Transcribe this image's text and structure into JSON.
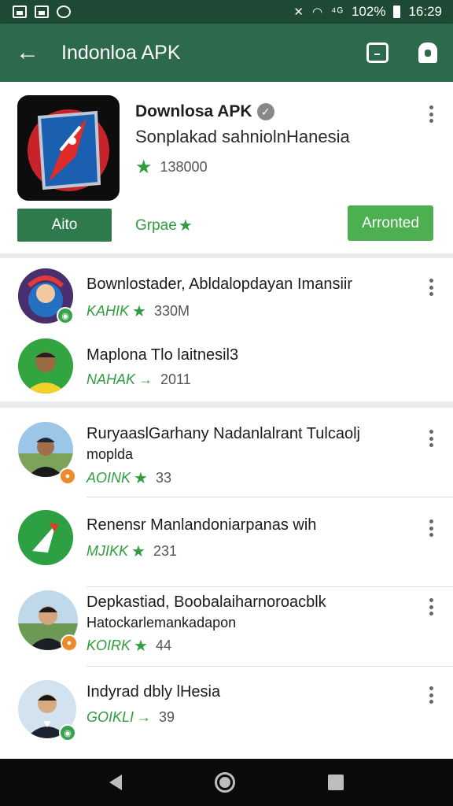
{
  "status_bar": {
    "battery_text": "102%",
    "time": "16:29",
    "signal_symbols": "⁴ᴳ"
  },
  "app_bar": {
    "title": "Indonloa APK",
    "icons": [
      "back-arrow-icon",
      "calendar-icon",
      "bell-icon"
    ]
  },
  "featured": {
    "title": "Downlosa APK",
    "subtitle": "Sonplakad sahniolnHanesia",
    "rating_count": "138000",
    "install_label": "Aito",
    "link_label": "Grpae",
    "accent_button_label": "Arronted"
  },
  "list_top": [
    {
      "title": "Bownlostader, Abldalopdayan Imansiir",
      "tag": "KAHIK",
      "count": "330M",
      "badge": "green",
      "meta_symbol": "★"
    },
    {
      "title": "Maplona Tlo laitnesil3",
      "tag": "NAHAK",
      "count": "2011",
      "badge": "none",
      "meta_symbol": "→"
    }
  ],
  "list_main": [
    {
      "title": "RuryaaslGarhany Nadanlalrant Tulcaolj",
      "title2": "moplda",
      "tag": "AOINK",
      "count": "33",
      "badge": "orange",
      "meta_symbol": "★"
    },
    {
      "title": "Renensr Manlandoniarpanas wih",
      "title2": "",
      "tag": "MJIKK",
      "count": "231",
      "badge": "none",
      "meta_symbol": "★"
    },
    {
      "title": "Depkastiad, Boobalaiharnoroacblk",
      "title2": "Hatockarlemankadapon",
      "tag": "KOIRK",
      "count": "44",
      "badge": "orange",
      "meta_symbol": "★"
    },
    {
      "title": "Indyrad dbly lHesia",
      "title2": "",
      "tag": "GOIKLI",
      "count": "39",
      "badge": "green",
      "meta_symbol": "→"
    }
  ],
  "colors": {
    "status_bar": "#1e4a35",
    "app_bar": "#2c6a4b",
    "install_button": "#2f7a4c",
    "accent_button": "#4caf50",
    "star": "#2e9e3e"
  }
}
